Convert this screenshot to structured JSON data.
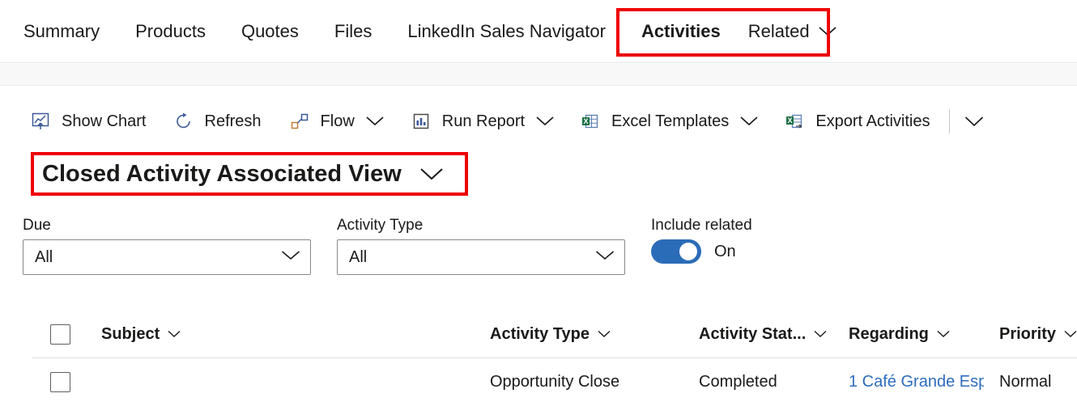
{
  "tabnav": {
    "tabs": [
      {
        "label": "Summary",
        "selected": false
      },
      {
        "label": "Products",
        "selected": false
      },
      {
        "label": "Quotes",
        "selected": false
      },
      {
        "label": "Files",
        "selected": false
      },
      {
        "label": "LinkedIn Sales Navigator",
        "selected": false
      },
      {
        "label": "Activities",
        "selected": true
      }
    ],
    "related": {
      "label": "Related",
      "caret_icon": "chevron-down-icon"
    }
  },
  "highlight": {
    "color": "#ee0000"
  },
  "commandbar": {
    "items": [
      {
        "label": "Show Chart",
        "icon": "show-chart-icon",
        "caret": false
      },
      {
        "label": "Refresh",
        "icon": "refresh-icon",
        "caret": false
      },
      {
        "label": "Flow",
        "icon": "flow-icon",
        "caret": true
      },
      {
        "label": "Run Report",
        "icon": "run-report-icon",
        "caret": true
      },
      {
        "label": "Excel Templates",
        "icon": "excel-templates-icon",
        "caret": true
      },
      {
        "label": "Export Activities",
        "icon": "export-activities-icon",
        "caret": false
      }
    ],
    "overflow": {
      "icon": "chevron-down-icon"
    }
  },
  "view_selector": {
    "label": "Closed Activity Associated View",
    "caret_icon": "chevron-down-icon"
  },
  "filters": {
    "due": {
      "label": "Due",
      "value": "All",
      "caret_icon": "chevron-down-icon"
    },
    "activity_type": {
      "label": "Activity Type",
      "value": "All",
      "caret_icon": "chevron-down-icon"
    },
    "include_related": {
      "label": "Include related",
      "state": "On",
      "on": true,
      "accent": "#2b6cb8"
    }
  },
  "grid": {
    "columns": [
      {
        "label": "Subject"
      },
      {
        "label": "Activity Type"
      },
      {
        "label": "Activity Stat..."
      },
      {
        "label": "Regarding"
      },
      {
        "label": "Priority"
      }
    ],
    "rows": [
      {
        "subject": "",
        "activity_type": "Opportunity Close",
        "activity_status": "Completed",
        "regarding": "1 Café Grande Esp",
        "regarding_is_link": true,
        "priority": "Normal"
      }
    ],
    "link_color": "#2f6cbd"
  }
}
